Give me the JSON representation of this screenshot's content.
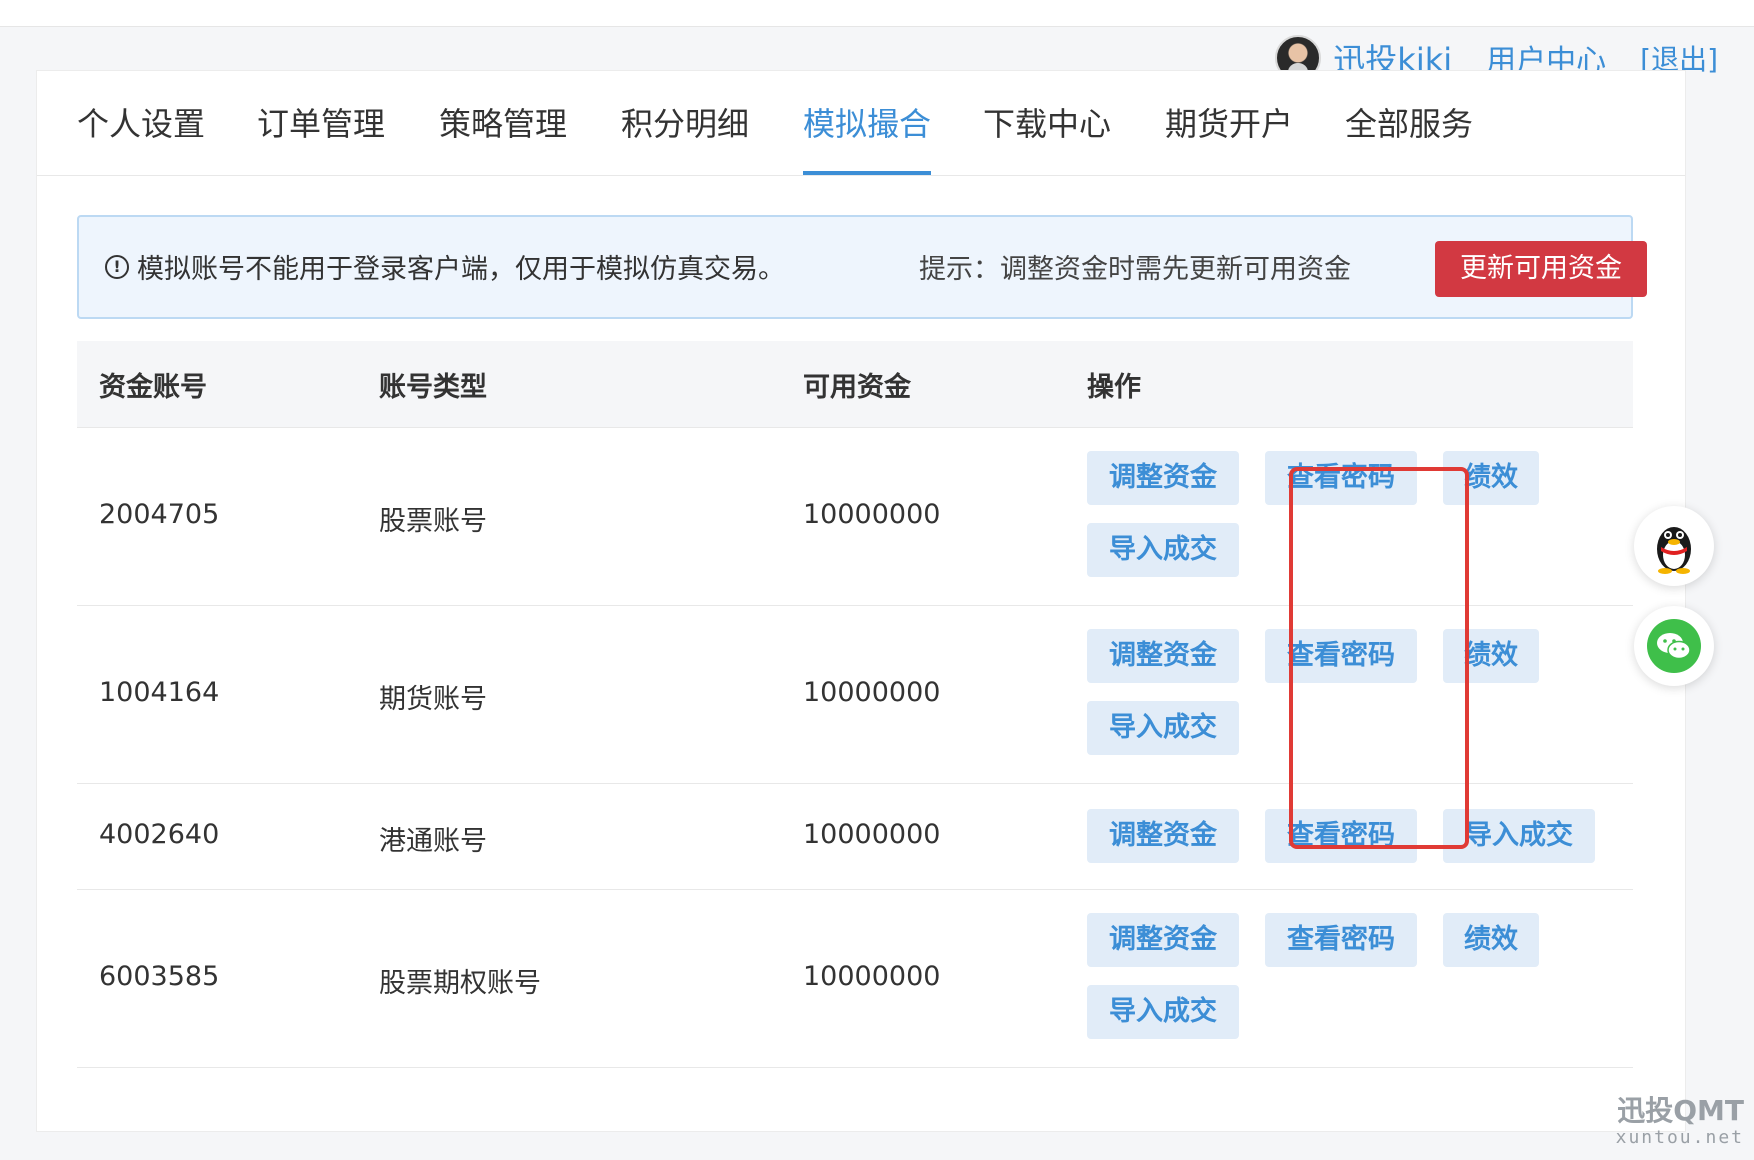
{
  "header": {
    "user_name": "迅投kiki",
    "user_center": "用户中心",
    "logout": "[退出]"
  },
  "tabs": [
    {
      "label": "个人设置",
      "active": false
    },
    {
      "label": "订单管理",
      "active": false
    },
    {
      "label": "策略管理",
      "active": false
    },
    {
      "label": "积分明细",
      "active": false
    },
    {
      "label": "模拟撮合",
      "active": true
    },
    {
      "label": "下载中心",
      "active": false
    },
    {
      "label": "期货开户",
      "active": false
    },
    {
      "label": "全部服务",
      "active": false
    }
  ],
  "notice": {
    "icon": "info-icon",
    "message": "模拟账号不能用于登录客户端，仅用于模拟仿真交易。",
    "hint": "提示：调整资金时需先更新可用资金",
    "update_button": "更新可用资金"
  },
  "table": {
    "columns": [
      "资金账号",
      "账号类型",
      "可用资金",
      "操作"
    ],
    "rows": [
      {
        "account": "2004705",
        "type": "股票账号",
        "funds": "10000000",
        "actions": [
          "调整资金",
          "查看密码",
          "绩效",
          "导入成交"
        ]
      },
      {
        "account": "1004164",
        "type": "期货账号",
        "funds": "10000000",
        "actions": [
          "调整资金",
          "查看密码",
          "绩效",
          "导入成交"
        ]
      },
      {
        "account": "4002640",
        "type": "港通账号",
        "funds": "10000000",
        "actions": [
          "调整资金",
          "查看密码",
          "导入成交"
        ]
      },
      {
        "account": "6003585",
        "type": "股票期权账号",
        "funds": "10000000",
        "actions": [
          "调整资金",
          "查看密码",
          "绩效",
          "导入成交"
        ]
      }
    ]
  },
  "floating": {
    "qq_icon": "qq-penguin-icon",
    "wechat_icon": "wechat-icon"
  },
  "watermark": {
    "title": "迅投QMT",
    "subtitle": "xuntou.net"
  },
  "colors": {
    "accent": "#3c8ed6",
    "danger": "#d23942",
    "highlight": "#e03a35"
  }
}
